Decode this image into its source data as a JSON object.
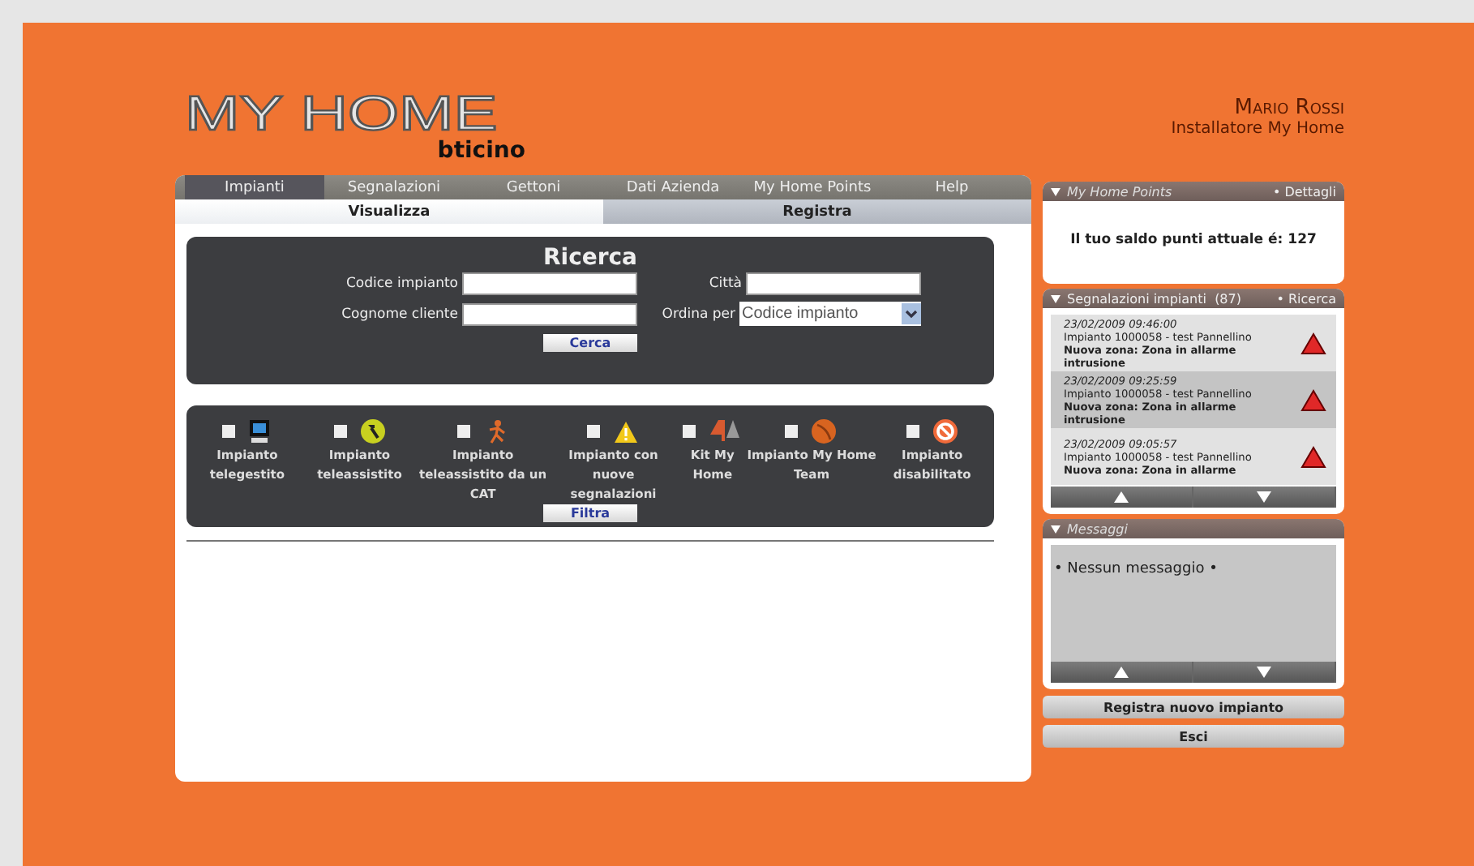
{
  "logo": {
    "title": "MY HOME",
    "brand": "bticino"
  },
  "user": {
    "name": "Mario Rossi",
    "role": "Installatore My Home"
  },
  "tabs": [
    {
      "label": "Impianti",
      "selected": true
    },
    {
      "label": "Segnalazioni",
      "selected": false
    },
    {
      "label": "Gettoni",
      "selected": false
    },
    {
      "label": "Dati Azienda",
      "selected": false
    },
    {
      "label": "My Home Points",
      "selected": false
    },
    {
      "label": "Help",
      "selected": false
    }
  ],
  "subtabs": [
    {
      "label": "Visualizza",
      "selected": true
    },
    {
      "label": "Registra",
      "selected": false
    }
  ],
  "search": {
    "title": "Ricerca",
    "fields": [
      {
        "label": "Codice impianto",
        "kind": "text"
      },
      {
        "label": "Città",
        "kind": "text"
      },
      {
        "label": "Cognome cliente",
        "kind": "text"
      },
      {
        "label": "Ordina per",
        "kind": "select",
        "value": "Codice impianto"
      }
    ],
    "button": "Cerca"
  },
  "filters": {
    "items": [
      {
        "label": "Impianto telegestito",
        "kind": "monitor",
        "checked": false
      },
      {
        "label": "Impianto teleassistito",
        "kind": "hammer",
        "checked": false
      },
      {
        "label": "Impianto teleassistito da un CAT",
        "kind": "figure",
        "checked": false
      },
      {
        "label": "Impianto con nuove segnalazioni",
        "kind": "warning",
        "checked": false
      },
      {
        "label": "Kit My Home",
        "kind": "kit",
        "checked": false
      },
      {
        "label": "Impianto My Home Team",
        "kind": "ball",
        "checked": false
      },
      {
        "label": "Impianto disabilitato",
        "kind": "forbidden",
        "checked": false
      }
    ],
    "button": "Filtra"
  },
  "points": {
    "title": "My Home Points",
    "link": "• Dettagli",
    "text": "Il tuo saldo punti attuale é: **127**"
  },
  "alerts": {
    "title": "Segnalazioni impianti",
    "count": "(87)",
    "link": "• Ricerca",
    "items": [
      {
        "date": "23/02/2009 09:46:00",
        "line1": "Impianto 1000058 - test Pannellino",
        "line2": "Nuova zona: Zona in allarme intrusione"
      },
      {
        "date": "23/02/2009 09:25:59",
        "line1": "Impianto 1000058 - test Pannellino",
        "line2": "Nuova zona: Zona in allarme intrusione"
      },
      {
        "date": "23/02/2009 09:05:57",
        "line1": "Impianto 1000058 - test Pannellino",
        "line2": "Nuova zona: Zona in allarme"
      }
    ]
  },
  "messages": {
    "title": "Messaggi",
    "text": "• Nessun messaggio •"
  },
  "actions": [
    "Registra nuovo impianto",
    "Esci"
  ]
}
